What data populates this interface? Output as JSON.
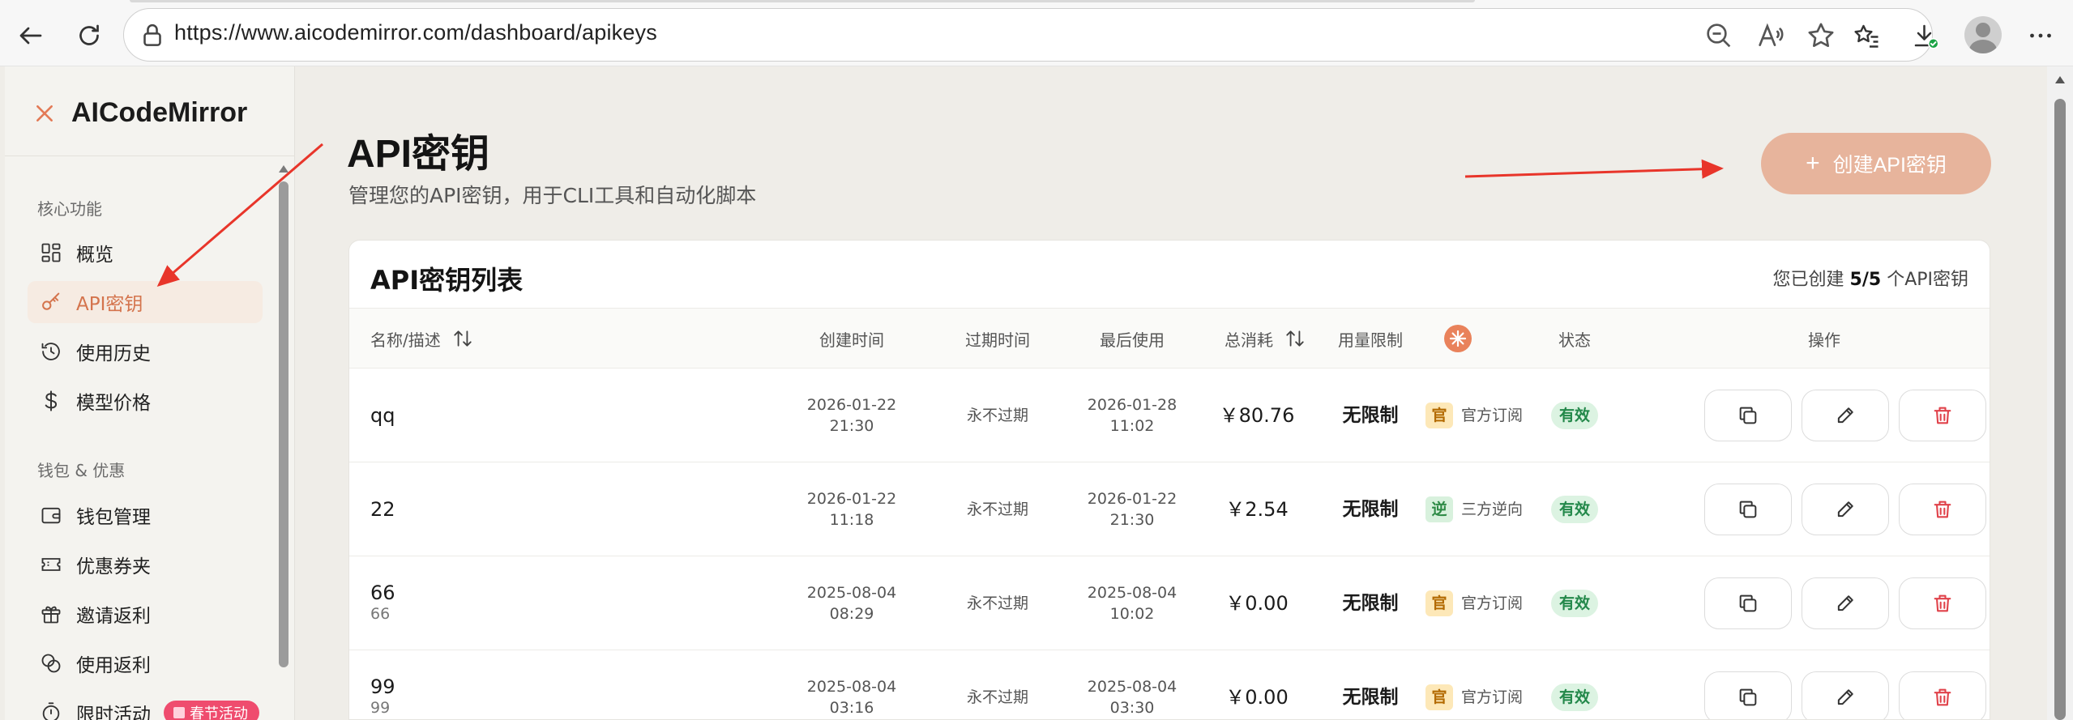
{
  "browser": {
    "url": "https://www.aicodemirror.com/dashboard/apikeys"
  },
  "sidebar": {
    "brand": "AICodeMirror",
    "sections": [
      {
        "label": "核心功能",
        "items": [
          {
            "label": "概览",
            "icon": "grid-icon",
            "active": false
          },
          {
            "label": "API密钥",
            "icon": "key-icon",
            "active": true
          },
          {
            "label": "使用历史",
            "icon": "history-icon",
            "active": false
          },
          {
            "label": "模型价格",
            "icon": "dollar-icon",
            "active": false
          }
        ]
      },
      {
        "label": "钱包 & 优惠",
        "items": [
          {
            "label": "钱包管理",
            "icon": "wallet-icon",
            "active": false
          },
          {
            "label": "优惠券夹",
            "icon": "ticket-icon",
            "active": false
          },
          {
            "label": "邀请返利",
            "icon": "gift-icon",
            "active": false
          },
          {
            "label": "使用返利",
            "icon": "coins-icon",
            "active": false
          },
          {
            "label": "限时活动",
            "icon": "timer-icon",
            "active": false,
            "badge": "春节活动"
          }
        ]
      }
    ]
  },
  "main": {
    "title": "API密钥",
    "subtitle": "管理您的API密钥，用于CLI工具和自动化脚本",
    "create_button": "创建API密钥",
    "card": {
      "title": "API密钥列表",
      "count_prefix": "您已创建",
      "count": "5/5",
      "count_suffix": "个API密钥",
      "columns": {
        "name": "名称/描述",
        "created": "创建时间",
        "expires": "过期时间",
        "last_used": "最后使用",
        "total_cost": "总消耗",
        "limit": "用量限制",
        "status": "状态",
        "actions": "操作"
      },
      "rows": [
        {
          "name": "qq",
          "desc": "",
          "created_date": "2026-01-22",
          "created_time": "21:30",
          "expires": "永不过期",
          "last_date": "2026-01-28",
          "last_time": "11:02",
          "cost": "￥80.76",
          "limit": "无限制",
          "source_tag": "官",
          "source": "官方订阅",
          "source_type": "official",
          "status": "有效"
        },
        {
          "name": "22",
          "desc": "",
          "created_date": "2026-01-22",
          "created_time": "11:18",
          "expires": "永不过期",
          "last_date": "2026-01-22",
          "last_time": "21:30",
          "cost": "￥2.54",
          "limit": "无限制",
          "source_tag": "逆",
          "source": "三方逆向",
          "source_type": "reverse",
          "status": "有效"
        },
        {
          "name": "66",
          "desc": "66",
          "created_date": "2025-08-04",
          "created_time": "08:29",
          "expires": "永不过期",
          "last_date": "2025-08-04",
          "last_time": "10:02",
          "cost": "￥0.00",
          "limit": "无限制",
          "source_tag": "官",
          "source": "官方订阅",
          "source_type": "official",
          "status": "有效"
        },
        {
          "name": "99",
          "desc": "99",
          "created_date": "2025-08-04",
          "created_time": "03:16",
          "expires": "永不过期",
          "last_date": "2025-08-04",
          "last_time": "03:30",
          "cost": "￥0.00",
          "limit": "无限制",
          "source_tag": "官",
          "source": "官方订阅",
          "source_type": "official",
          "status": "有效"
        }
      ]
    }
  },
  "colors": {
    "accent": "#d4744d",
    "create_button": "#e7b49c",
    "status_green": "#23884a",
    "delete_red": "#e0424a",
    "annotation_red": "#e8352a"
  }
}
